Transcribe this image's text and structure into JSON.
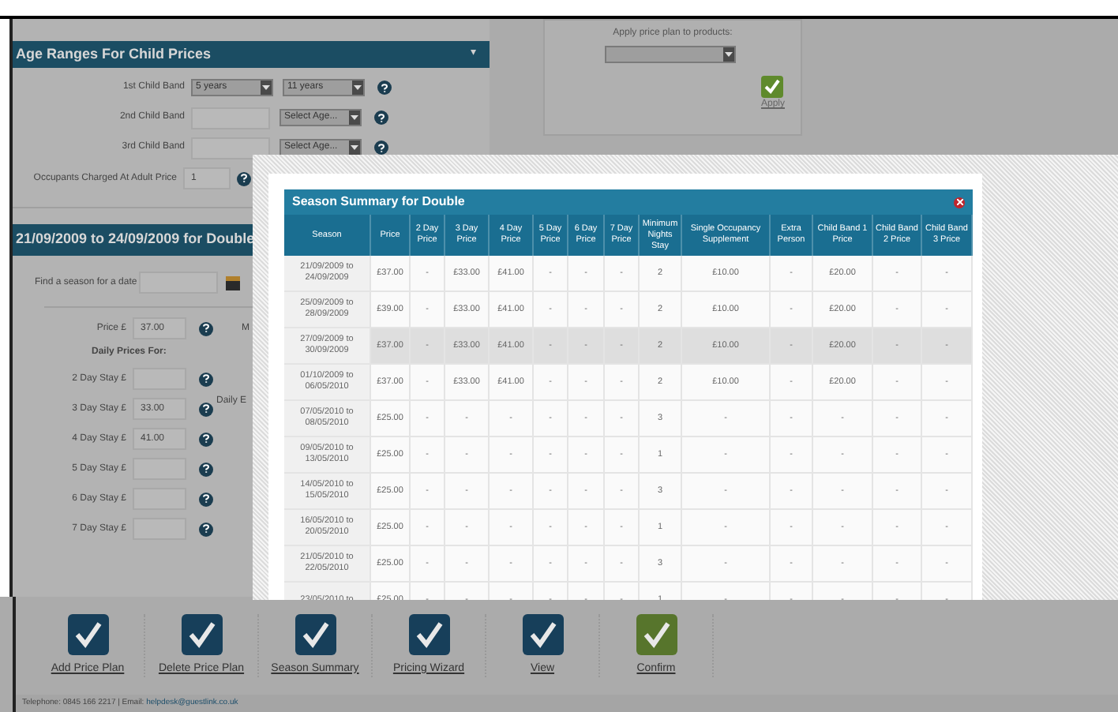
{
  "child_prices": {
    "title": "Age Ranges For Child Prices",
    "caret": "▾",
    "rows": [
      {
        "label": "1st Child Band",
        "from": {
          "kind": "select",
          "value": "5 years"
        },
        "to": "11 years"
      },
      {
        "label": "2nd Child Band",
        "from": {
          "kind": "input"
        },
        "to": "Select Age..."
      },
      {
        "label": "3rd Child Band",
        "from": {
          "kind": "input"
        },
        "to": "Select Age..."
      }
    ],
    "adult": {
      "label": "Occupants Charged At Adult Price",
      "value": "1"
    }
  },
  "season_panel": {
    "title": "21/09/2009 to 24/09/2009 for Double",
    "find_label": "Find a season for a date",
    "price_label": "Price £",
    "price_value": "37.00",
    "daily_title": "Daily Prices For:",
    "side_texts": [
      "M",
      "Daily E"
    ],
    "days": [
      {
        "label": "2 Day Stay £"
      },
      {
        "label": "3 Day Stay £",
        "value": "33.00"
      },
      {
        "label": "4 Day Stay £",
        "value": "41.00"
      },
      {
        "label": "5 Day Stay £"
      },
      {
        "label": "6 Day Stay £"
      },
      {
        "label": "7 Day Stay £"
      }
    ]
  },
  "apply_box": {
    "label": "Apply price plan to products:",
    "button": "Apply"
  },
  "modal": {
    "title": "Season Summary for Double",
    "columns": [
      "Season",
      "Price",
      "2 Day Price",
      "3 Day Price",
      "4 Day Price",
      "5 Day Price",
      "6 Day Price",
      "7 Day Price",
      "Minimum Nights Stay",
      "Single Occupancy Supplement",
      "Extra Person",
      "Child Band 1 Price",
      "Child Band 2 Price",
      "Child Band 3 Price"
    ],
    "rows": [
      {
        "highlighted": false,
        "cells": [
          "21/09/2009 to 24/09/2009",
          "£37.00",
          "-",
          "£33.00",
          "£41.00",
          "-",
          "-",
          "-",
          "2",
          "£10.00",
          "-",
          "£20.00",
          "-",
          "-"
        ]
      },
      {
        "highlighted": false,
        "cells": [
          "25/09/2009 to 28/09/2009",
          "£39.00",
          "-",
          "£33.00",
          "£41.00",
          "-",
          "-",
          "-",
          "2",
          "£10.00",
          "-",
          "£20.00",
          "-",
          "-"
        ]
      },
      {
        "highlighted": true,
        "cells": [
          "27/09/2009 to 30/09/2009",
          "£37.00",
          "-",
          "£33.00",
          "£41.00",
          "-",
          "-",
          "-",
          "2",
          "£10.00",
          "-",
          "£20.00",
          "-",
          "-"
        ]
      },
      {
        "highlighted": false,
        "cells": [
          "01/10/2009 to 06/05/2010",
          "£37.00",
          "-",
          "£33.00",
          "£41.00",
          "-",
          "-",
          "-",
          "2",
          "£10.00",
          "-",
          "£20.00",
          "-",
          "-"
        ]
      },
      {
        "highlighted": false,
        "cells": [
          "07/05/2010 to 08/05/2010",
          "£25.00",
          "-",
          "-",
          "-",
          "-",
          "-",
          "-",
          "3",
          "-",
          "-",
          "-",
          "-",
          "-"
        ]
      },
      {
        "highlighted": false,
        "cells": [
          "09/05/2010 to 13/05/2010",
          "£25.00",
          "-",
          "-",
          "-",
          "-",
          "-",
          "-",
          "1",
          "-",
          "-",
          "-",
          "-",
          "-"
        ]
      },
      {
        "highlighted": false,
        "cells": [
          "14/05/2010 to 15/05/2010",
          "£25.00",
          "-",
          "-",
          "-",
          "-",
          "-",
          "-",
          "3",
          "-",
          "-",
          "-",
          "-",
          "-"
        ]
      },
      {
        "highlighted": false,
        "cells": [
          "16/05/2010 to 20/05/2010",
          "£25.00",
          "-",
          "-",
          "-",
          "-",
          "-",
          "-",
          "1",
          "-",
          "-",
          "-",
          "-",
          "-"
        ]
      },
      {
        "highlighted": false,
        "cells": [
          "21/05/2010 to 22/05/2010",
          "£25.00",
          "-",
          "-",
          "-",
          "-",
          "-",
          "-",
          "3",
          "-",
          "-",
          "-",
          "-",
          "-"
        ]
      },
      {
        "highlighted": false,
        "cells": [
          "23/05/2010 to",
          "£25.00",
          "-",
          "-",
          "-",
          "-",
          "-",
          "-",
          "1",
          "-",
          "-",
          "-",
          "-",
          "-"
        ]
      }
    ]
  },
  "toolbar": [
    {
      "label": "Add Price Plan",
      "kind": "navy"
    },
    {
      "label": "Delete Price Plan",
      "kind": "navy"
    },
    {
      "label": "Season Summary",
      "kind": "navy"
    },
    {
      "label": "Pricing Wizard",
      "kind": "navy"
    },
    {
      "label": "View",
      "kind": "navy"
    },
    {
      "label": "Confirm",
      "kind": "green"
    }
  ],
  "footer": {
    "text": "Telephone: 0845 166 2217 | Email: ",
    "email": "helpdesk@guestlink.co.uk"
  }
}
